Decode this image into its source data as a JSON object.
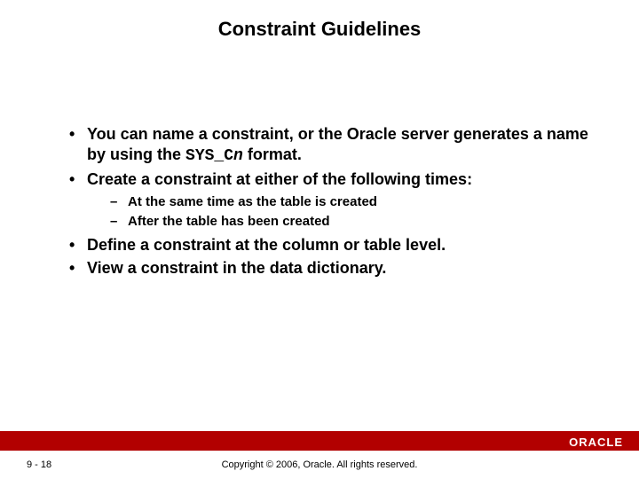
{
  "title": "Constraint Guidelines",
  "bullets": {
    "b1_pre": "You can name a constraint, or the Oracle server generates a name by using the ",
    "b1_code1": "SYS_C",
    "b1_codeI": "n",
    "b1_post": " format.",
    "b2": "Create a constraint at either of the following times:",
    "b2a": "At the same time as the table is created",
    "b2b": "After the table has been created",
    "b3": "Define a constraint at the column or table level.",
    "b4": "View a constraint in the data dictionary."
  },
  "footer": {
    "page": "9 - 18",
    "copyright": "Copyright © 2006, Oracle. All rights reserved.",
    "logo": "ORACLE"
  }
}
